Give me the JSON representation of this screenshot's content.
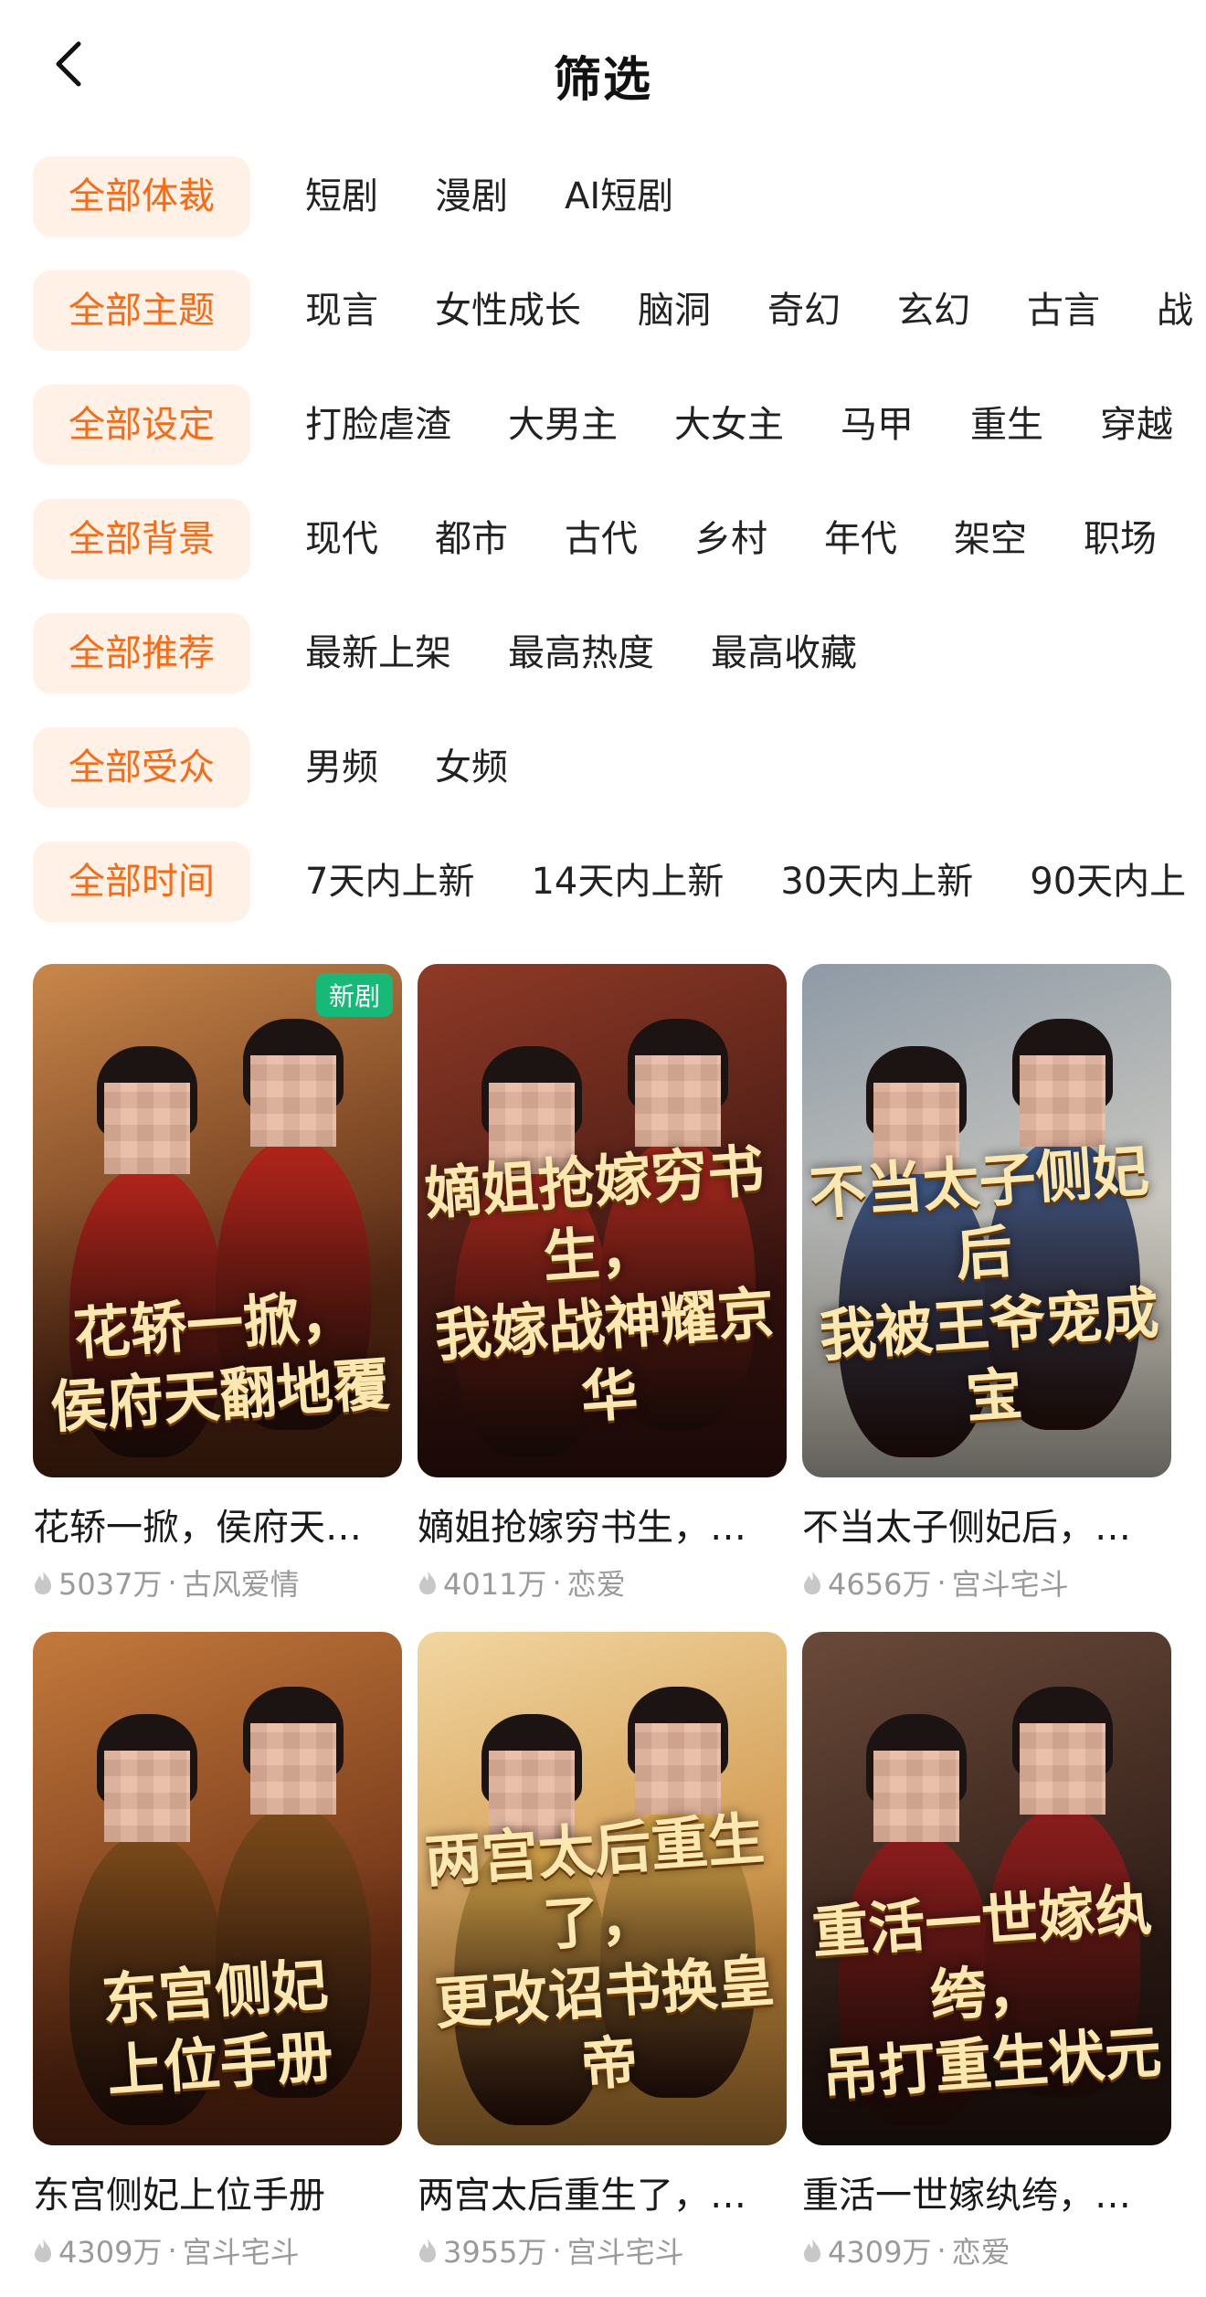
{
  "header": {
    "title": "筛选"
  },
  "filters": [
    {
      "head": "全部体裁",
      "options": [
        "短剧",
        "漫剧",
        "AI短剧"
      ]
    },
    {
      "head": "全部主题",
      "options": [
        "现言",
        "女性成长",
        "脑洞",
        "奇幻",
        "玄幻",
        "古言",
        "战"
      ]
    },
    {
      "head": "全部设定",
      "options": [
        "打脸虐渣",
        "大男主",
        "大女主",
        "马甲",
        "重生",
        "穿越"
      ]
    },
    {
      "head": "全部背景",
      "options": [
        "现代",
        "都市",
        "古代",
        "乡村",
        "年代",
        "架空",
        "职场"
      ]
    },
    {
      "head": "全部推荐",
      "options": [
        "最新上架",
        "最高热度",
        "最高收藏"
      ]
    },
    {
      "head": "全部受众",
      "options": [
        "男频",
        "女频"
      ]
    },
    {
      "head": "全部时间",
      "options": [
        "7天内上新",
        "14天内上新",
        "30天内上新",
        "90天内上"
      ]
    }
  ],
  "cards": [
    {
      "title": "花轿一掀，侯府天…",
      "views": "5037万",
      "genre": "古风爱情",
      "badge": "新剧",
      "caption_l1": "花轿一掀，",
      "caption_l2": "侯府天翻地覆",
      "colors": {
        "bg1": "#5a2a14",
        "bg2": "#c9874a",
        "robe": "#b3241b"
      }
    },
    {
      "title": "嫡姐抢嫁穷书生，…",
      "views": "4011万",
      "genre": "恋爱",
      "badge": "",
      "caption_l1": "嫡姐抢嫁穷书生，",
      "caption_l2": "我嫁战神耀京华",
      "colors": {
        "bg1": "#3a1410",
        "bg2": "#8f3a26",
        "robe": "#a8281d"
      }
    },
    {
      "title": "不当太子侧妃后，…",
      "views": "4656万",
      "genre": "宫斗宅斗",
      "badge": "",
      "caption_l1": "不当太子侧妃后",
      "caption_l2": "我被王爷宠成宝",
      "colors": {
        "bg1": "#d7d2c6",
        "bg2": "#8e9aa6",
        "robe": "#3f5b8a"
      }
    },
    {
      "title": "东宫侧妃上位手册",
      "views": "4309万",
      "genre": "宫斗宅斗",
      "badge": "",
      "caption_l1": "东宫侧妃",
      "caption_l2": "上位手册",
      "colors": {
        "bg1": "#6a2e14",
        "bg2": "#c47a3c",
        "robe": "#7a4a1a"
      }
    },
    {
      "title": "两宫太后重生了，…",
      "views": "3955万",
      "genre": "宫斗宅斗",
      "badge": "",
      "caption_l1": "两宫太后重生了，",
      "caption_l2": "更改诏书换皇帝",
      "colors": {
        "bg1": "#c88a3c",
        "bg2": "#f2d6a0",
        "robe": "#d9a94a"
      }
    },
    {
      "title": "重活一世嫁纨绔，…",
      "views": "4309万",
      "genre": "恋爱",
      "badge": "",
      "caption_l1": "重活一世嫁纨绔，",
      "caption_l2": "吊打重生状元",
      "colors": {
        "bg1": "#2c1a14",
        "bg2": "#6a4a3a",
        "robe": "#8c1d1d"
      }
    }
  ]
}
